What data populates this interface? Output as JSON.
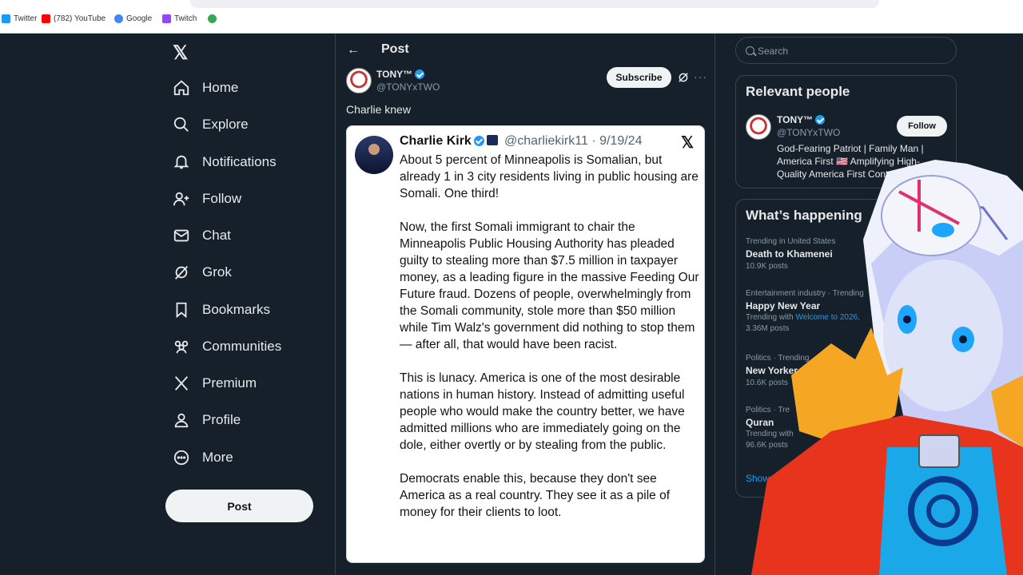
{
  "bookmarks": [
    {
      "label": "Twitter",
      "color": "#1d9bf0"
    },
    {
      "label": "(782) YouTube",
      "color": "#ff0000"
    },
    {
      "label": "Google",
      "color": "#4285f4"
    },
    {
      "label": "Twitch",
      "color": "#9146ff"
    }
  ],
  "nav": {
    "logo": "𝕏",
    "items": [
      {
        "label": "Home",
        "icon": "home-icon"
      },
      {
        "label": "Explore",
        "icon": "search-icon"
      },
      {
        "label": "Notifications",
        "icon": "bell-icon"
      },
      {
        "label": "Follow",
        "icon": "person-add-icon"
      },
      {
        "label": "Chat",
        "icon": "mail-icon"
      },
      {
        "label": "Grok",
        "icon": "grok-icon"
      },
      {
        "label": "Bookmarks",
        "icon": "bookmark-icon"
      },
      {
        "label": "Communities",
        "icon": "communities-icon"
      },
      {
        "label": "Premium",
        "icon": "x-icon"
      },
      {
        "label": "Profile",
        "icon": "person-icon"
      },
      {
        "label": "More",
        "icon": "more-circle-icon"
      }
    ],
    "post_label": "Post"
  },
  "post": {
    "header_title": "Post",
    "author_name": "TONY™",
    "author_handle": "@TONYxTWO",
    "subscribe_label": "Subscribe",
    "text": "Charlie knew",
    "embed": {
      "name": "Charlie Kirk",
      "handle_date": "@charliekirk11 · 9/19/24",
      "paragraphs": [
        "About 5 percent of Minneapolis is Somalian, but already 1 in 3 city residents living in public housing are Somali. One third!",
        "Now, the first Somali immigrant to chair the Minneapolis Public Housing Authority has pleaded guilty to stealing more than $7.5 million in taxpayer money, as a leading figure in the massive Feeding Our Future fraud. Dozens of people, overwhelmingly from the Somali community, stole more than $50 million while Tim Walz's government did nothing to stop them — after all, that would have been racist.",
        "This is lunacy. America is one of the most desirable nations in human history. Instead of admitting useful people who would make the country better, we have admitted millions who are immediately going on the dole, either overtly or by stealing from the public.",
        "Democrats enable this, because they don't see America as a real country. They see it as a pile of money for their clients to loot."
      ]
    }
  },
  "sidebar": {
    "search_placeholder": "Search",
    "relevant_title": "Relevant people",
    "person": {
      "name": "TONY™",
      "handle": "@TONYxTWO",
      "follow_label": "Follow",
      "bio": "God-Fearing Patriot | Family Man | America First 🇺🇸 Amplifying High-Quality America First Content"
    },
    "happening_title": "What’s happening",
    "trends": [
      {
        "context": "Trending in United States",
        "title": "Death to Khamenei",
        "with": "",
        "link": "",
        "count": "10.9K posts"
      },
      {
        "context": "Entertainment industry · Trending",
        "title": "Happy New Year",
        "with": "Trending with",
        "link": "Welcome to 2026,",
        "count": "3.36M posts"
      },
      {
        "context": "Politics · Trending",
        "title": "New Yorker",
        "with": "",
        "link": "",
        "count": "10.6K posts"
      },
      {
        "context": "Politics · Tre",
        "title": "Quran",
        "with": "Trending with",
        "link": "",
        "count": "96.6K posts"
      }
    ],
    "show_more": "Show"
  },
  "colors": {
    "accent": "#1d9bf0",
    "background": "#15202b",
    "border": "#38444d"
  }
}
